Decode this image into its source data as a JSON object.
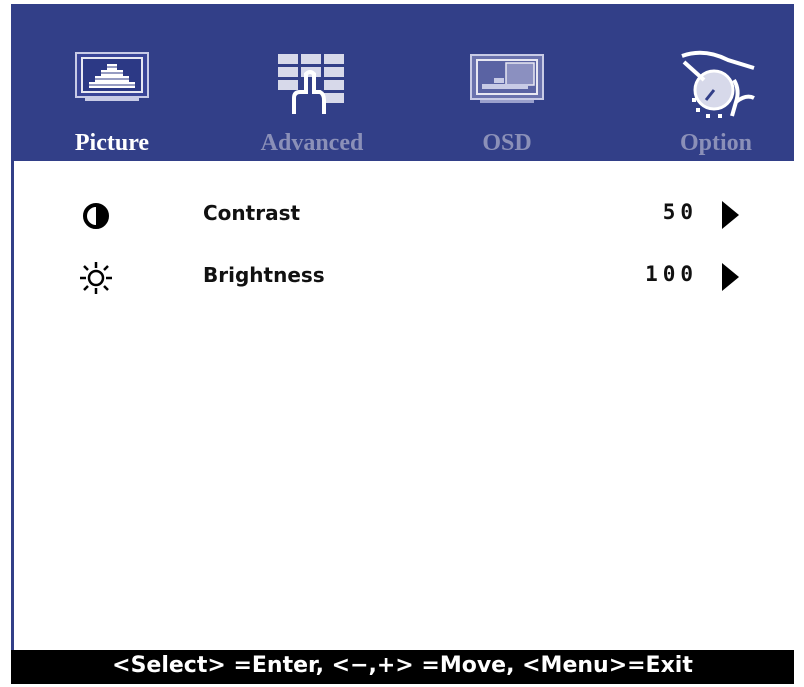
{
  "colors": {
    "header_bg": "#323f88",
    "active_label": "#ffffff",
    "inactive_label": "#8b90b8",
    "footer_bg": "#000000",
    "text": "#111111"
  },
  "tabs": [
    {
      "label": "Picture",
      "icon": "picture-icon",
      "active": true
    },
    {
      "label": "Advanced",
      "icon": "advanced-icon",
      "active": false
    },
    {
      "label": "OSD",
      "icon": "osd-icon",
      "active": false
    },
    {
      "label": "Option",
      "icon": "option-icon",
      "active": false
    }
  ],
  "settings": [
    {
      "label": "Contrast",
      "value": "50",
      "icon": "contrast-icon"
    },
    {
      "label": "Brightness",
      "value": "100",
      "icon": "brightness-icon"
    }
  ],
  "footer": {
    "hint": "<Select> =Enter, <−,+> =Move, <Menu>=Exit"
  }
}
